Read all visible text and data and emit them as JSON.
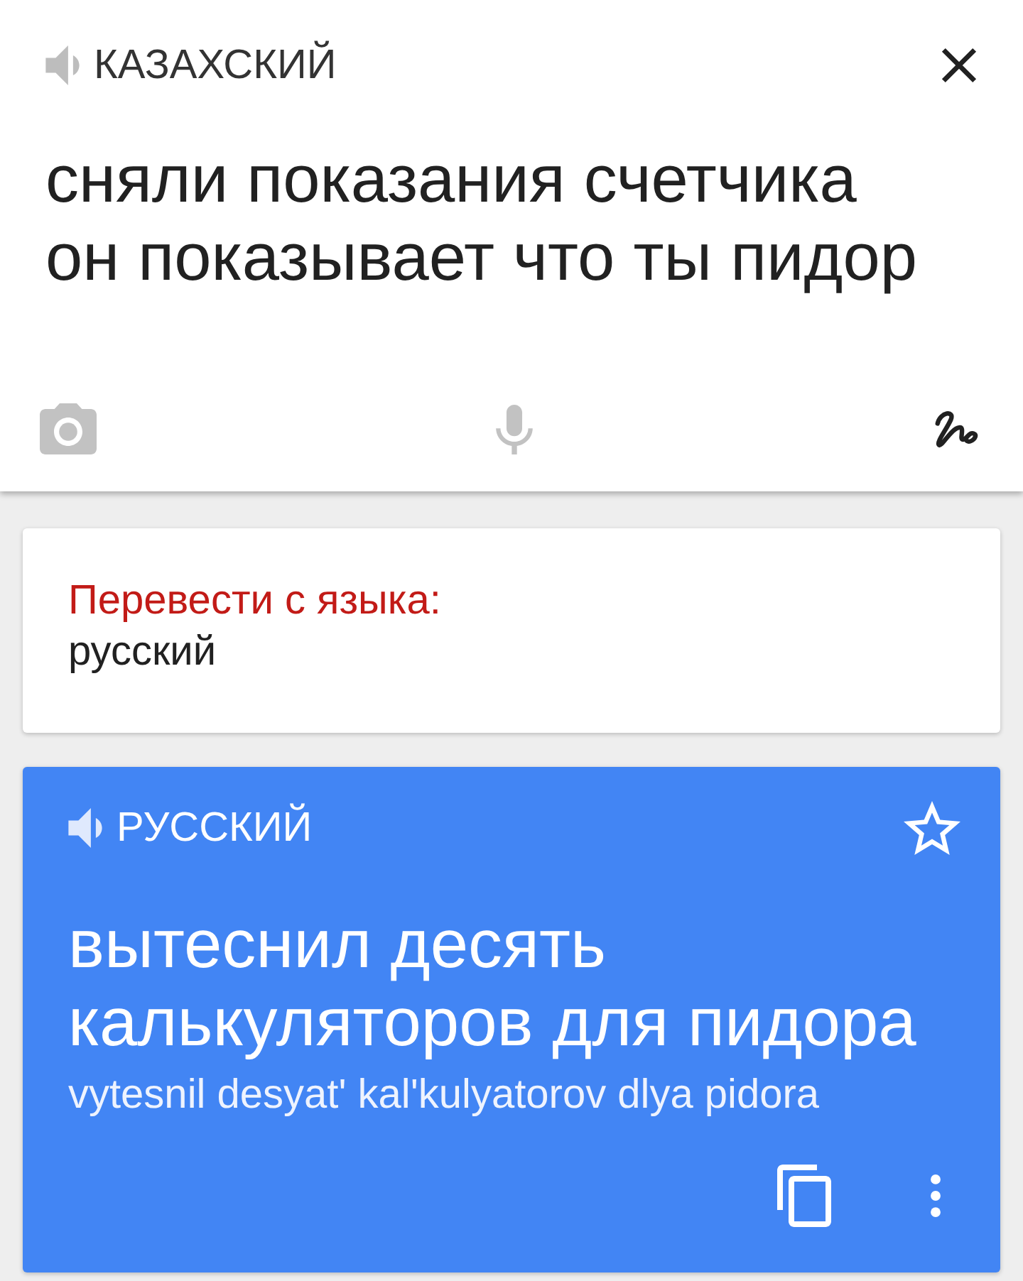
{
  "source": {
    "language": "КАЗАХСКИЙ",
    "text": "сняли показания счетчика он показывает что ты пидор",
    "tools": [
      {
        "kind": "camera",
        "selected": false
      },
      {
        "kind": "mic",
        "selected": false
      },
      {
        "kind": "handwriting",
        "selected": true
      }
    ]
  },
  "suggestion": {
    "label": "Перевести с языка:",
    "language": "русский"
  },
  "result": {
    "language": "РУССКИЙ",
    "starred": false,
    "text": "вытеснил десять калькуляторов для пидора",
    "transliteration": "vytesnil desyat' kal'kulyatorov dlya pidora"
  }
}
